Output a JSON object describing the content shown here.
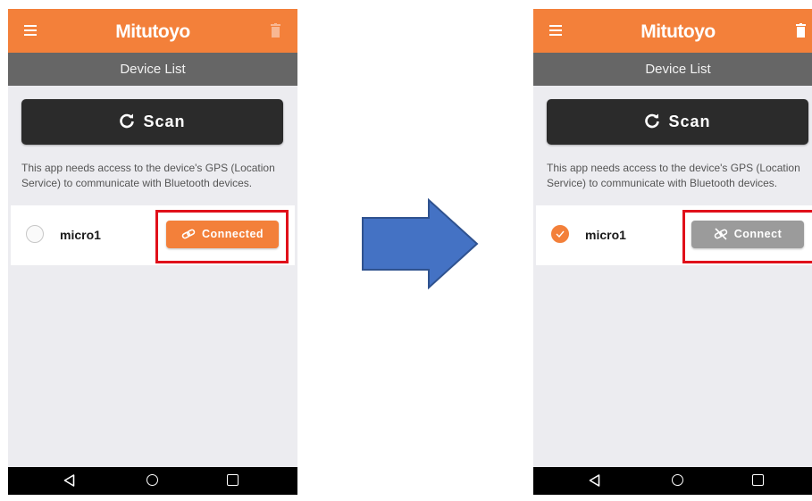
{
  "colors": {
    "accent": "#f3803a",
    "subbar": "#666666",
    "scan_button": "#2b2b2b",
    "screen_background": "#ececf0",
    "highlight": "#e0101a",
    "connect_inactive": "#9b9b9b",
    "arrow_fill": "#4472c4",
    "arrow_stroke": "#2f528f"
  },
  "before": {
    "header": {
      "brand": "Mitutoyo",
      "menu_icon": "hamburger-icon",
      "delete_icon": "trash-icon"
    },
    "subheader": {
      "title": "Device List"
    },
    "scan_button": {
      "label": "Scan",
      "icon": "refresh-icon"
    },
    "notice": "This app needs access to the device's GPS (Location Service) to communicate with Bluetooth devices.",
    "device": {
      "name": "micro1",
      "selected": false,
      "button_label": "Connected",
      "button_icon": "link-icon"
    },
    "nav": {
      "back": "back-icon",
      "home": "home-icon",
      "recent": "recent-apps-icon"
    }
  },
  "after": {
    "header": {
      "brand": "Mitutoyo",
      "menu_icon": "hamburger-icon",
      "delete_icon": "trash-icon"
    },
    "subheader": {
      "title": "Device List"
    },
    "scan_button": {
      "label": "Scan",
      "icon": "refresh-icon"
    },
    "notice": "This app needs access to the device's GPS (Location Service) to communicate with Bluetooth devices.",
    "device": {
      "name": "micro1",
      "selected": true,
      "button_label": "Connect",
      "button_icon": "unlink-icon"
    },
    "nav": {
      "back": "back-icon",
      "home": "home-icon",
      "recent": "recent-apps-icon"
    }
  },
  "transition_icon": "right-arrow-icon"
}
